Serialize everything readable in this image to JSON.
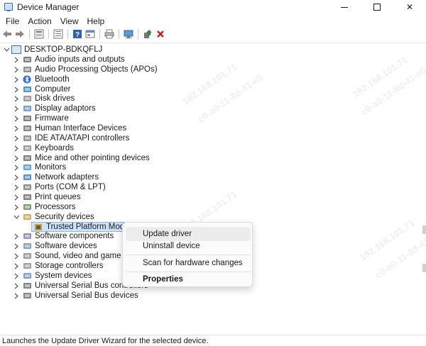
{
  "window": {
    "title": "Device Manager",
    "minimize": "minimize",
    "maximize": "maximize",
    "close": "✕"
  },
  "menu": [
    "File",
    "Action",
    "View",
    "Help"
  ],
  "toolbar": {
    "icons": [
      "back-arrow-icon",
      "forward-arrow-icon",
      "properties-icon",
      "list-view-icon",
      "help-icon",
      "details-icon",
      "print-icon",
      "scan-monitor-icon",
      "update-driver-icon",
      "uninstall-icon"
    ]
  },
  "tree": {
    "root": "DESKTOP-BDKQFLJ",
    "categories": [
      {
        "label": "Audio inputs and outputs",
        "icon": "speaker-icon"
      },
      {
        "label": "Audio Processing Objects (APOs)",
        "icon": "audio-apo-icon"
      },
      {
        "label": "Bluetooth",
        "icon": "bluetooth-icon"
      },
      {
        "label": "Computer",
        "icon": "computer-icon"
      },
      {
        "label": "Disk drives",
        "icon": "disk-icon"
      },
      {
        "label": "Display adaptors",
        "icon": "display-adapter-icon"
      },
      {
        "label": "Firmware",
        "icon": "firmware-icon"
      },
      {
        "label": "Human Interface Devices",
        "icon": "hid-icon"
      },
      {
        "label": "IDE ATA/ATAPI controllers",
        "icon": "ide-icon"
      },
      {
        "label": "Keyboards",
        "icon": "keyboard-icon"
      },
      {
        "label": "Mice and other pointing devices",
        "icon": "mouse-icon"
      },
      {
        "label": "Monitors",
        "icon": "monitor-icon"
      },
      {
        "label": "Network adapters",
        "icon": "network-icon"
      },
      {
        "label": "Ports (COM & LPT)",
        "icon": "port-icon"
      },
      {
        "label": "Print queues",
        "icon": "printer-icon"
      },
      {
        "label": "Processors",
        "icon": "processor-icon"
      },
      {
        "label": "Security devices",
        "icon": "security-icon"
      },
      {
        "label": "Software components",
        "icon": "software-component-icon"
      },
      {
        "label": "Software devices",
        "icon": "software-device-icon"
      },
      {
        "label": "Sound, video and game contro",
        "icon": "sound-icon"
      },
      {
        "label": "Storage controllers",
        "icon": "storage-icon"
      },
      {
        "label": "System devices",
        "icon": "system-icon"
      },
      {
        "label": "Universal Serial Bus controllers",
        "icon": "usb-icon"
      },
      {
        "label": "Universal Serial Bus devices",
        "icon": "usb-device-icon"
      }
    ],
    "selected_child": "Trusted Platform Module 2.0"
  },
  "context_menu": {
    "items": [
      "Update driver",
      "Uninstall device",
      "Scan for hardware changes",
      "Properties"
    ]
  },
  "status": "Launches the Update Driver Wizard for the selected device.",
  "watermark": [
    "192.168.101.71",
    "c0-a0-11-8d-41-e5"
  ],
  "colors": {
    "accent": "#3a6fb0",
    "selection": "#cde2fb",
    "uninstall_red": "#d01818",
    "update_green": "#2e8b3a"
  }
}
